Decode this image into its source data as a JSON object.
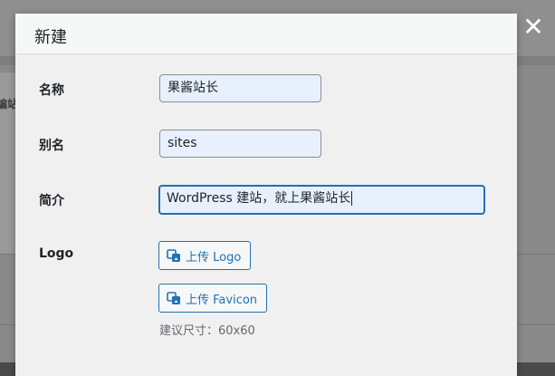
{
  "background": {
    "partial_text": "编站"
  },
  "close_icon": "close-icon",
  "modal": {
    "title": "新建",
    "fields": {
      "name": {
        "label": "名称",
        "value": "果酱站长"
      },
      "alias": {
        "label": "别名",
        "value": "sites"
      },
      "intro": {
        "label": "简介",
        "value": "WordPress 建站，就上果酱站长"
      },
      "logo": {
        "label": "Logo",
        "upload_logo_label": "上传 Logo",
        "upload_favicon_label": "上传 Favicon",
        "size_hint": "建议尺寸：60x60"
      }
    }
  },
  "colors": {
    "accent": "#2271b1",
    "input_fill": "#e8f0fe"
  }
}
